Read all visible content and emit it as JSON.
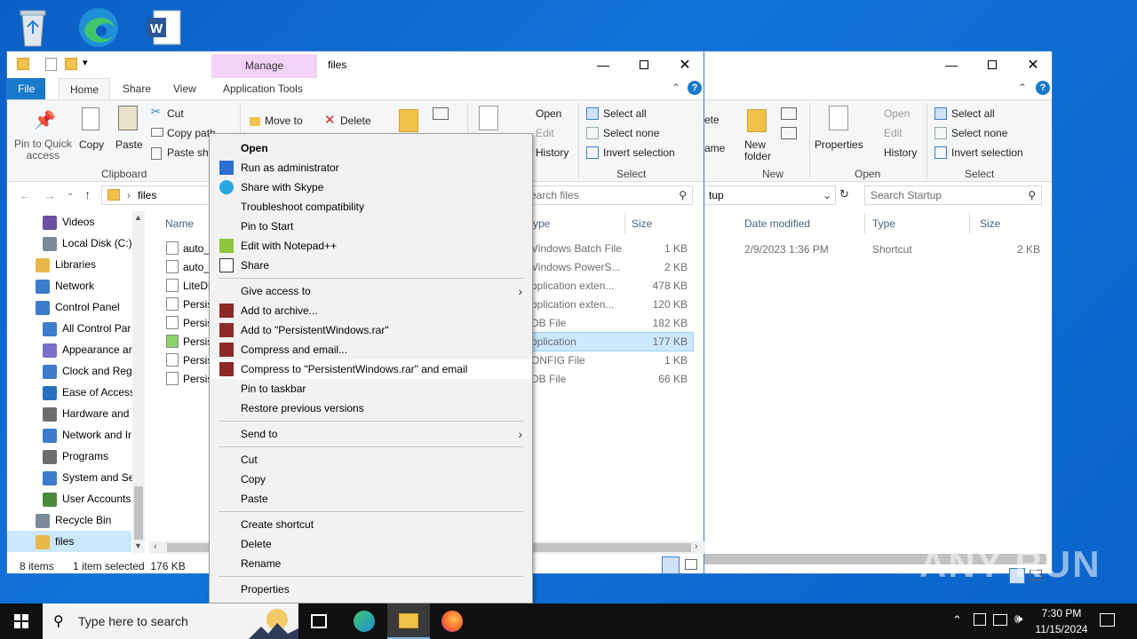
{
  "desktop": {
    "icons": [
      "recycle-bin-icon",
      "edge-icon",
      "word-icon"
    ]
  },
  "back_window": {
    "ribbon": {
      "delete_partial": "ete",
      "rename_partial": "ame",
      "new_folder": "New\nfolder",
      "properties": "Properties",
      "open": "Open",
      "edit": "Edit",
      "history": "History",
      "select_all": "Select all",
      "select_none": "Select none",
      "invert_selection": "Invert selection",
      "group_new": "New",
      "group_open": "Open",
      "group_select": "Select"
    },
    "address_partial": "tup",
    "search_placeholder": "Search Startup",
    "columns": {
      "date_modified": "Date modified",
      "type": "Type",
      "size": "Size"
    },
    "row": {
      "date": "2/9/2023 1:36 PM",
      "type": "Shortcut",
      "size": "2 KB"
    }
  },
  "front_window": {
    "title": "files",
    "manage_tab": "Manage",
    "tabs": {
      "file": "File",
      "home": "Home",
      "share": "Share",
      "view": "View",
      "app_tools": "Application Tools"
    },
    "ribbon": {
      "pin_quick": "Pin to Quick\naccess",
      "copy": "Copy",
      "paste": "Paste",
      "cut": "Cut",
      "copy_path": "Copy path",
      "paste_shortcut": "Paste sho",
      "clipboard": "Clipboard",
      "move_to": "Move to",
      "delete": "Delete",
      "open": "Open",
      "edit": "Edit",
      "history": "History",
      "select_all": "Select all",
      "select_none": "Select none",
      "invert_selection": "Invert selection",
      "group_select": "Select"
    },
    "address": "files",
    "search_placeholder": "earch files",
    "columns": {
      "name": "Name",
      "type": "ype",
      "size": "Size"
    },
    "files": [
      {
        "name": "auto_",
        "type": "Vindows Batch File",
        "size": "1 KB"
      },
      {
        "name": "auto_",
        "type": "Vindows PowerS...",
        "size": "2 KB"
      },
      {
        "name": "LiteDl",
        "type": "pplication exten...",
        "size": "478 KB"
      },
      {
        "name": "Persis",
        "type": "pplication exten...",
        "size": "120 KB"
      },
      {
        "name": "Persis",
        "type": "DB File",
        "size": "182 KB"
      },
      {
        "name": "Persis",
        "type": "pplication",
        "size": "177 KB"
      },
      {
        "name": "Persis",
        "type": "ONFIG File",
        "size": "1 KB"
      },
      {
        "name": "Persis",
        "type": "DB File",
        "size": "66 KB"
      }
    ],
    "nav": [
      {
        "label": "Videos",
        "icon": "videos-icon",
        "color": "#6b4fa0"
      },
      {
        "label": "Local Disk (C:)",
        "icon": "disk-icon",
        "color": "#7a8a99"
      },
      {
        "label": "Libraries",
        "icon": "libraries-icon",
        "color": "#e8b84a"
      },
      {
        "label": "Network",
        "icon": "network-icon",
        "color": "#3d7cc9"
      },
      {
        "label": "Control Panel",
        "icon": "control-panel-icon",
        "color": "#3d7cc9"
      },
      {
        "label": "All Control Par",
        "icon": "all-control-icon",
        "color": "#3d7cc9"
      },
      {
        "label": "Appearance an",
        "icon": "appearance-icon",
        "color": "#7a6fc9"
      },
      {
        "label": "Clock and Regi",
        "icon": "clock-icon",
        "color": "#3d7cc9"
      },
      {
        "label": "Ease of Access",
        "icon": "ease-access-icon",
        "color": "#2a6fbd"
      },
      {
        "label": "Hardware and",
        "icon": "hardware-icon",
        "color": "#6d6d6d"
      },
      {
        "label": "Network and Ir",
        "icon": "network-internet-icon",
        "color": "#3d7cc9"
      },
      {
        "label": "Programs",
        "icon": "programs-icon",
        "color": "#6d6d6d"
      },
      {
        "label": "System and Sec",
        "icon": "system-security-icon",
        "color": "#3d7cc9"
      },
      {
        "label": "User Accounts",
        "icon": "user-accounts-icon",
        "color": "#4a8a3d"
      },
      {
        "label": "Recycle Bin",
        "icon": "recycle-icon",
        "color": "#7a8a99"
      },
      {
        "label": "files",
        "icon": "folder-icon",
        "color": "#e8b84a"
      }
    ],
    "status_items": "8 items",
    "status_selected": "1 item selected  176 KB"
  },
  "context_menu": [
    {
      "label": "Open",
      "bold": true
    },
    {
      "label": "Run as administrator",
      "icon": "shield-icon"
    },
    {
      "label": "Share with Skype",
      "icon": "skype-icon"
    },
    {
      "label": "Troubleshoot compatibility"
    },
    {
      "label": "Pin to Start"
    },
    {
      "label": "Edit with Notepad++",
      "icon": "notepadpp-icon"
    },
    {
      "label": "Share",
      "icon": "share-icon"
    },
    {
      "sep": true
    },
    {
      "label": "Give access to",
      "submenu": true
    },
    {
      "label": "Add to archive...",
      "icon": "winrar-icon"
    },
    {
      "label": "Add to \"PersistentWindows.rar\"",
      "icon": "winrar-icon"
    },
    {
      "label": "Compress and email...",
      "icon": "winrar-icon"
    },
    {
      "label": "Compress to \"PersistentWindows.rar\" and email",
      "icon": "winrar-icon",
      "highlight": true
    },
    {
      "label": "Pin to taskbar"
    },
    {
      "label": "Restore previous versions"
    },
    {
      "sep": true
    },
    {
      "label": "Send to",
      "submenu": true
    },
    {
      "sep": true
    },
    {
      "label": "Cut"
    },
    {
      "label": "Copy"
    },
    {
      "label": "Paste"
    },
    {
      "sep": true
    },
    {
      "label": "Create shortcut"
    },
    {
      "label": "Delete"
    },
    {
      "label": "Rename"
    },
    {
      "sep": true
    },
    {
      "label": "Properties"
    }
  ],
  "taskbar": {
    "search_placeholder": "Type here to search",
    "time": "7:30 PM",
    "date": "11/15/2024"
  },
  "watermark": "ANY RUN"
}
